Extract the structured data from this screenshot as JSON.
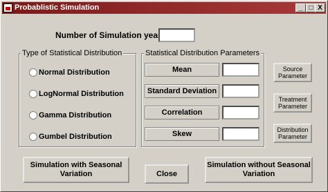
{
  "window": {
    "title": "Probablistic Simulation",
    "controls": {
      "minimize": "_",
      "maximize": "□",
      "close": "X"
    }
  },
  "simulation_years": {
    "label": "Number of Simulation years",
    "value": ""
  },
  "distribution_type": {
    "title": "Type of Statistical Distribution",
    "options": [
      {
        "label": "Normal Distribution",
        "selected": false
      },
      {
        "label": "LogNormal Distribution",
        "selected": false
      },
      {
        "label": "Gamma Distribution",
        "selected": false
      },
      {
        "label": "Gumbel Distribution",
        "selected": false
      }
    ]
  },
  "parameters": {
    "title": "Statistical Distribution Parameters",
    "items": [
      {
        "label": "Mean",
        "value": ""
      },
      {
        "label": "Standard Deviation",
        "value": ""
      },
      {
        "label": "Correlation",
        "value": ""
      },
      {
        "label": "Skew",
        "value": ""
      }
    ]
  },
  "side_buttons": {
    "source": {
      "line1": "Source",
      "line2": "Parameter"
    },
    "treatment": {
      "line1": "Treatment",
      "line2": "Parameter"
    },
    "distribution": {
      "line1": "Distribution",
      "line2": "Parameter"
    }
  },
  "bottom_buttons": {
    "seasonal": {
      "line1": "Simulation with Seasonal",
      "line2": "Variation"
    },
    "close": "Close",
    "no_seasonal": {
      "line1": "Simulation without Seasonal",
      "line2": "Variation"
    }
  }
}
